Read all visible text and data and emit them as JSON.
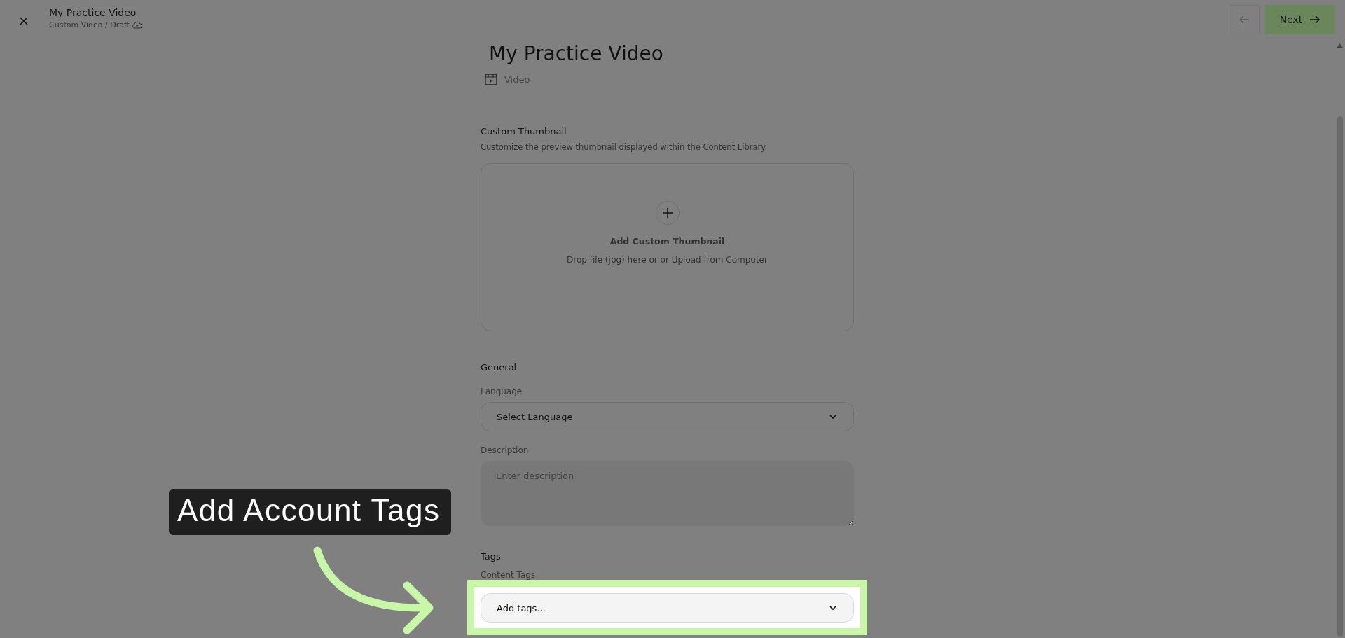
{
  "header": {
    "title": "My Practice Video",
    "breadcrumb": "Custom Video / Draft",
    "next_label": "Next"
  },
  "page": {
    "title": "My Practice Video",
    "type": "Video"
  },
  "thumbnail": {
    "heading": "Custom Thumbnail",
    "description": "Customize the preview thumbnail displayed within the Content Library.",
    "action": "Add Custom Thumbnail",
    "hint": "Drop file (jpg) here or or Upload from Computer"
  },
  "sections": [
    {
      "heading": "General",
      "fields": [
        {
          "kind": "select",
          "label": "Language",
          "value": "Select Language",
          "highlighted": false
        },
        {
          "kind": "textarea",
          "label": "Description",
          "placeholder": "Enter description",
          "highlighted": false
        }
      ]
    },
    {
      "heading": "Tags",
      "fields": [
        {
          "kind": "select",
          "label": "Content Tags",
          "value": "Add tags...",
          "highlighted": true
        }
      ]
    }
  ],
  "callout": {
    "text": "Add Account Tags"
  }
}
